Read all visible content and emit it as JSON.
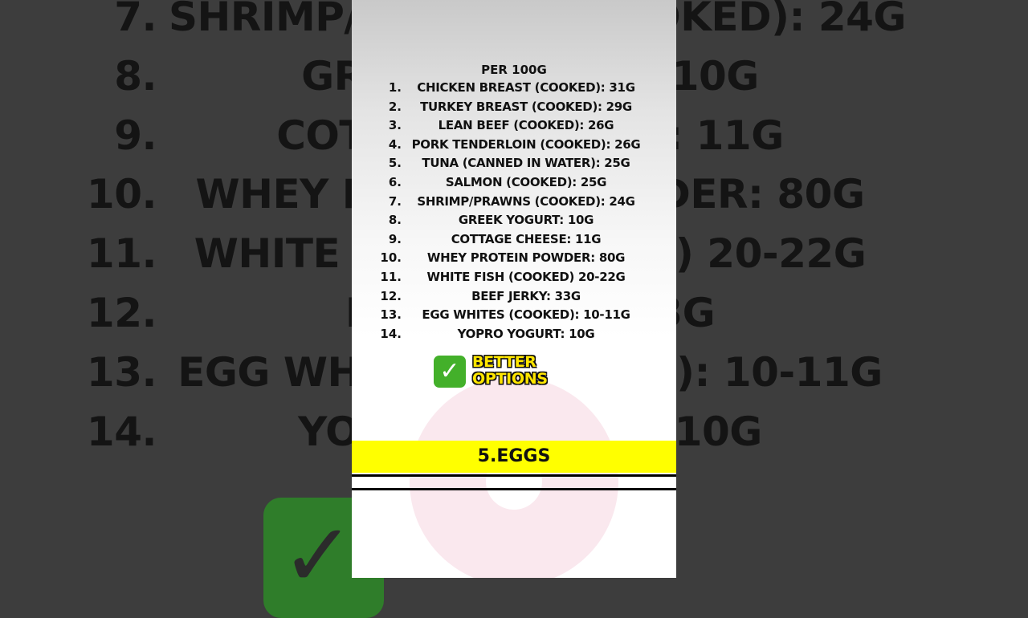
{
  "background_list": [
    {
      "num": "7.",
      "text": "SHRIMP/PRAWNS (COOKED): 24G"
    },
    {
      "num": "8.",
      "text": "GREEK YOGURT: 10G"
    },
    {
      "num": "9.",
      "text": "COTTAGE CHEESE: 11G"
    },
    {
      "num": "10.",
      "text": "WHEY PROTEIN POWDER: 80G"
    },
    {
      "num": "11.",
      "text": "WHITE FISH (COOKED) 20-22G"
    },
    {
      "num": "12.",
      "text": "BEEF JERKY: 33G"
    },
    {
      "num": "13.",
      "text": "EGG WHITES (COOKED): 10-11G"
    },
    {
      "num": "14.",
      "text": "YOPRO YOGURT: 10G"
    }
  ],
  "header": "PER 100G",
  "items": [
    {
      "num": "1.",
      "text": "CHICKEN BREAST (COOKED): 31G"
    },
    {
      "num": "2.",
      "text": "TURKEY BREAST (COOKED): 29G"
    },
    {
      "num": "3.",
      "text": "LEAN BEEF (COOKED): 26G"
    },
    {
      "num": "4.",
      "text": "PORK TENDERLOIN (COOKED): 26G"
    },
    {
      "num": "5.",
      "text": "TUNA (CANNED IN WATER): 25G"
    },
    {
      "num": "6.",
      "text": "SALMON (COOKED): 25G"
    },
    {
      "num": "7.",
      "text": "SHRIMP/PRAWNS (COOKED): 24G"
    },
    {
      "num": "8.",
      "text": "GREEK YOGURT: 10G"
    },
    {
      "num": "9.",
      "text": "COTTAGE CHEESE: 11G"
    },
    {
      "num": "10.",
      "text": "WHEY PROTEIN POWDER: 80G"
    },
    {
      "num": "11.",
      "text": "WHITE FISH (COOKED) 20-22G"
    },
    {
      "num": "12.",
      "text": "BEEF JERKY: 33G"
    },
    {
      "num": "13.",
      "text": "EGG WHITES (COOKED): 10-11G"
    },
    {
      "num": "14.",
      "text": "YOPRO YOGURT: 10G"
    }
  ],
  "badge": {
    "icon": "check-mark-icon",
    "line1": "BETTER",
    "line2": "OPTIONS"
  },
  "caption": "5.EGGS",
  "colors": {
    "caption_bar": "#ffff00",
    "check": "#43b02a",
    "badge_text": "#ffe600"
  }
}
